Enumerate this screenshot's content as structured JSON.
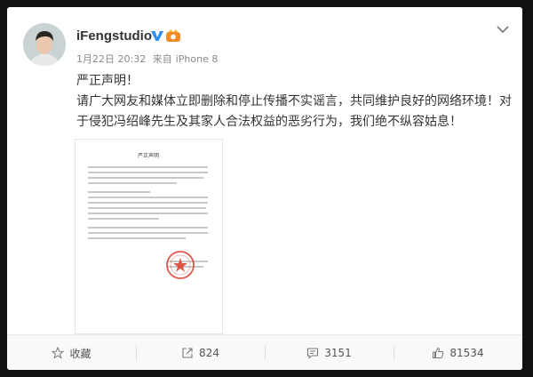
{
  "post": {
    "username": "iFengstudio",
    "timestamp": "1月22日 20:32",
    "source_prefix": "来自",
    "source": "iPhone 8",
    "text_lines": [
      "严正声明！",
      "请广大网友和媒体立即删除和停止传播不实谣言，共同维护良好的网络环境！对",
      "于侵犯冯绍峰先生及其家人合法权益的恶劣行为，我们绝不纵容姑息！"
    ],
    "image": {
      "doc_title": "严正声明"
    }
  },
  "actions": {
    "favorite_label": "收藏",
    "repost_count": "824",
    "comment_count": "3151",
    "like_count": "81534"
  },
  "icons": {
    "more": "chevron-down-icon",
    "verified": "verified-v-icon",
    "member": "member-crown-icon",
    "favorite": "star-icon",
    "repost": "share-icon",
    "comment": "comment-icon",
    "like": "thumbs-up-icon"
  },
  "colors": {
    "verified_blue": "#2f8ff0",
    "member_orange": "#f28c26",
    "stamp_red": "#d93a2b"
  }
}
